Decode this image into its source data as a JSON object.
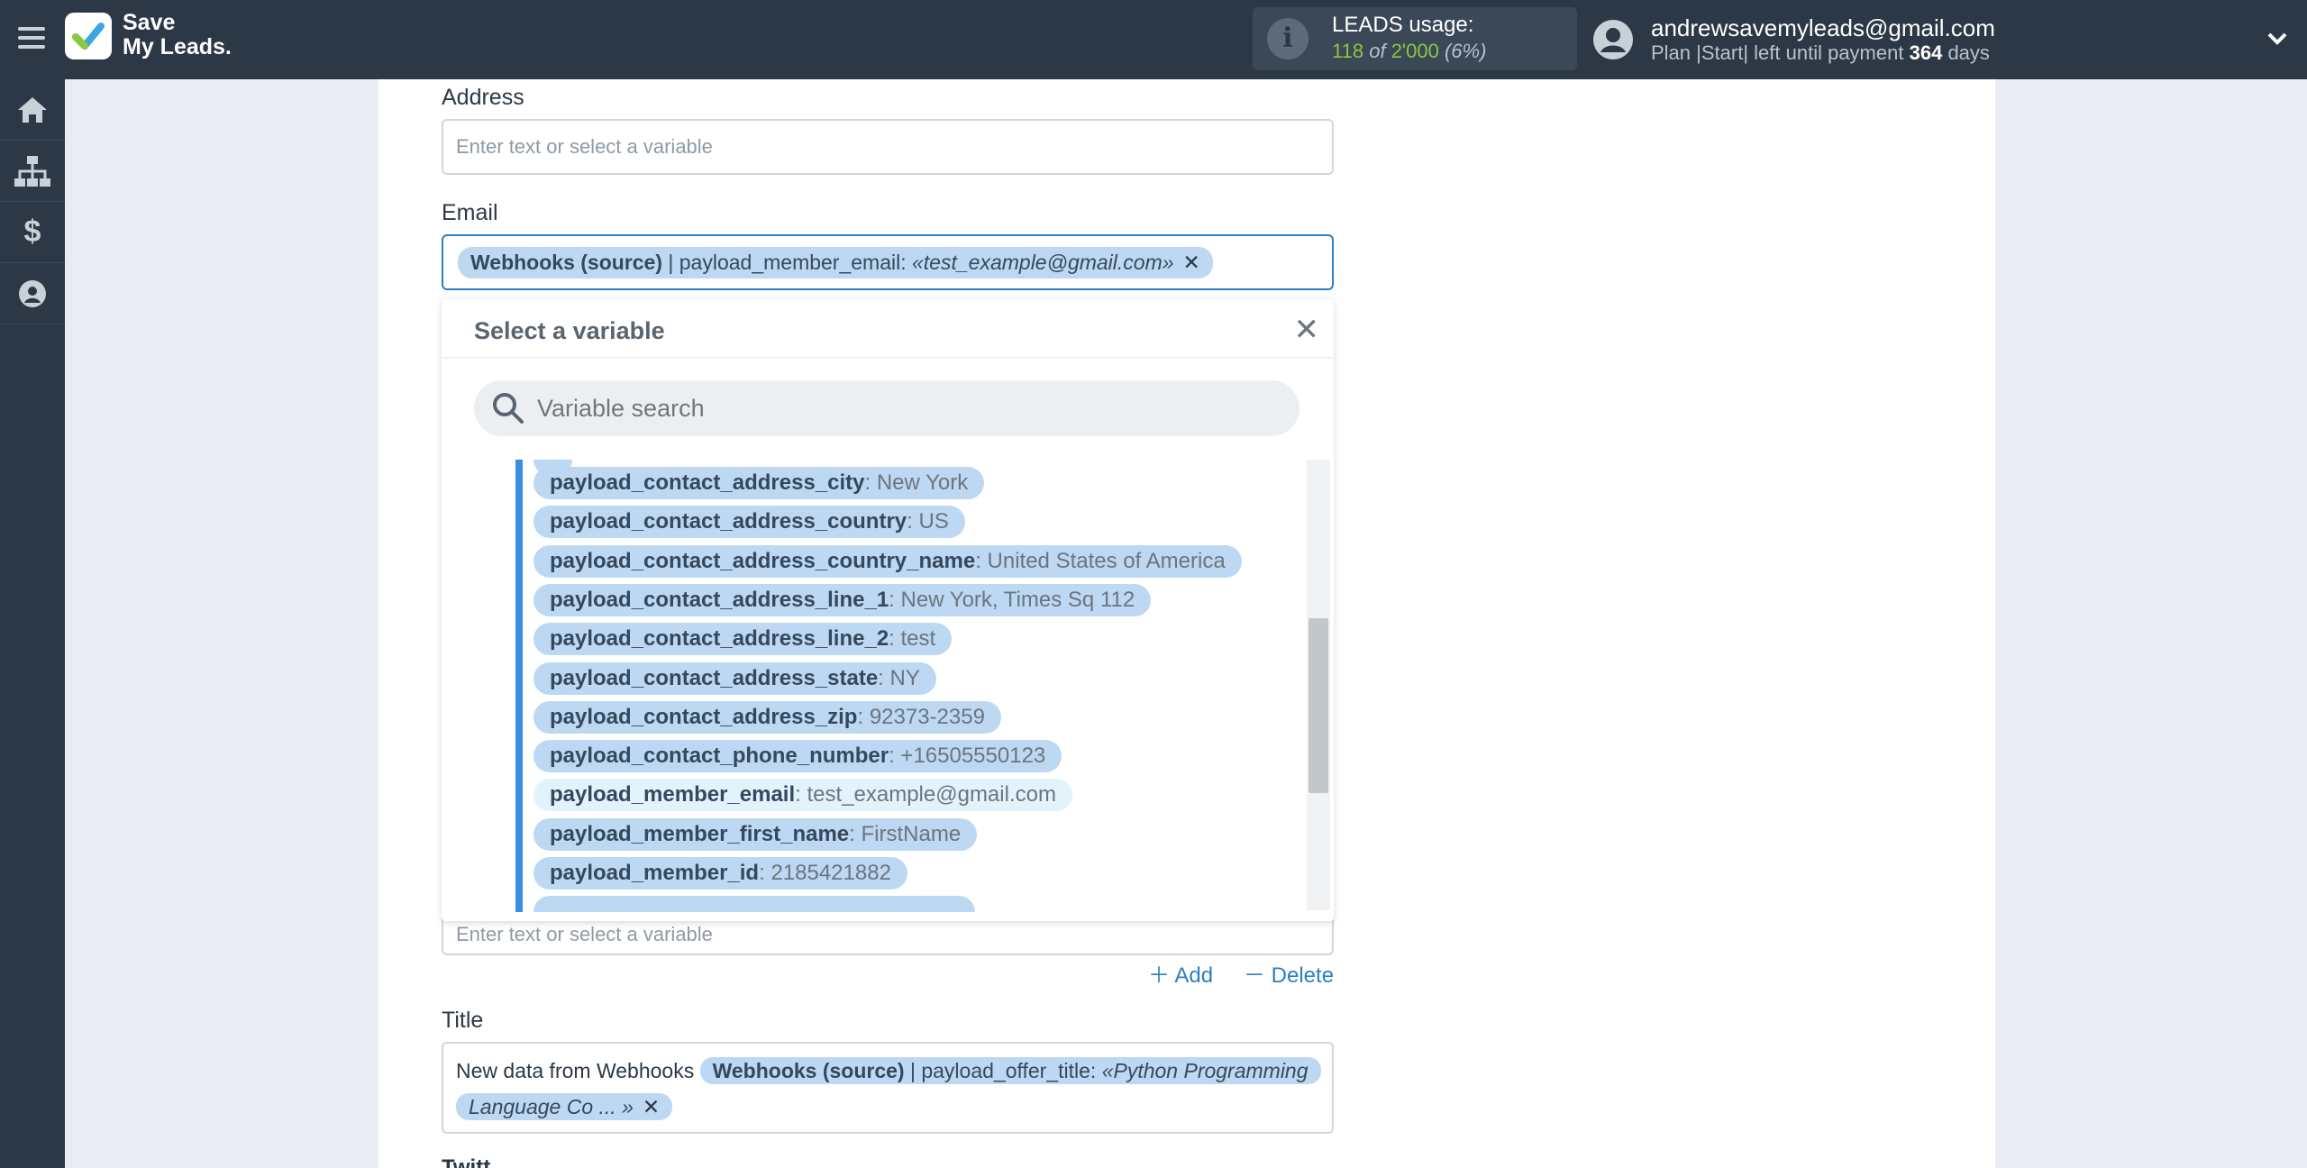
{
  "header": {
    "logo_line1": "Save",
    "logo_line2": "My Leads.",
    "usage_label": "LEADS usage:",
    "usage_used": "118",
    "usage_of": "of",
    "usage_total": "2'000",
    "usage_percent": "(6%)",
    "user_email": "andrewsavemyleads@gmail.com",
    "plan_prefix": "Plan |Start| left until payment",
    "plan_days": "364",
    "plan_suffix": "days"
  },
  "sidebar": {
    "items": [
      {
        "icon": "home-icon"
      },
      {
        "icon": "sitemap-icon"
      },
      {
        "icon": "dollar-icon"
      },
      {
        "icon": "user-icon"
      }
    ]
  },
  "form": {
    "address_label": "Address",
    "address_placeholder": "Enter text or select a variable",
    "email_label": "Email",
    "email_tag_source": "Webhooks (source)",
    "email_tag_sep": " | payload_member_email: ",
    "email_tag_value": "«test_example@gmail.com»",
    "hidden_field_placeholder": "Enter text or select a variable",
    "add_label": "Add",
    "delete_label": "Delete",
    "title_label": "Title",
    "title_static_text": "New data from Webhooks",
    "title_tag_source": "Webhooks (source)",
    "title_tag_sep": " | payload_offer_title: ",
    "title_tag_value": "«Python Programming Language Co ... »",
    "next_label_partial": "Twitt"
  },
  "dropdown": {
    "title": "Select a variable",
    "search_placeholder": "Variable search",
    "variables": [
      {
        "name": "payload_contact_address_city",
        "value": "New York"
      },
      {
        "name": "payload_contact_address_country",
        "value": "US"
      },
      {
        "name": "payload_contact_address_country_name",
        "value": "United States of America"
      },
      {
        "name": "payload_contact_address_line_1",
        "value": "New York, Times Sq 112"
      },
      {
        "name": "payload_contact_address_line_2",
        "value": "test"
      },
      {
        "name": "payload_contact_address_state",
        "value": "NY"
      },
      {
        "name": "payload_contact_address_zip",
        "value": "92373-2359"
      },
      {
        "name": "payload_contact_phone_number",
        "value": "+16505550123"
      },
      {
        "name": "payload_member_email",
        "value": "test_example@gmail.com",
        "selected": true
      },
      {
        "name": "payload_member_first_name",
        "value": "FirstName"
      },
      {
        "name": "payload_member_id",
        "value": "2185421882"
      }
    ]
  },
  "colors": {
    "topbar": "#2c3845",
    "accent": "#2b7fc4",
    "tag": "#bdd8f2",
    "usage_green": "#8dc63f"
  }
}
